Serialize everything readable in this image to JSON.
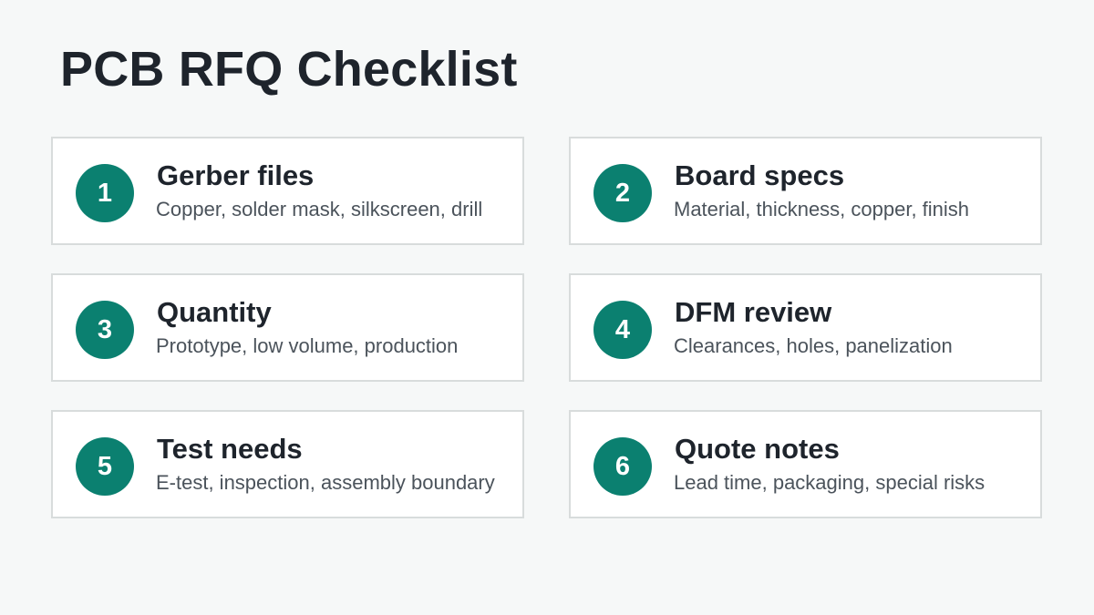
{
  "title": "PCB RFQ Checklist",
  "colors": {
    "background": "#f6f8f8",
    "card_background": "#ffffff",
    "card_border": "#d8dcdc",
    "accent": "#0b8070",
    "title_text": "#1e242c",
    "description_text": "#4b535b"
  },
  "items": [
    {
      "number": "1",
      "title": "Gerber files",
      "description": "Copper, solder mask, silkscreen, drill"
    },
    {
      "number": "2",
      "title": "Board specs",
      "description": "Material, thickness, copper, finish"
    },
    {
      "number": "3",
      "title": "Quantity",
      "description": "Prototype, low volume, production"
    },
    {
      "number": "4",
      "title": "DFM review",
      "description": "Clearances, holes, panelization"
    },
    {
      "number": "5",
      "title": "Test needs",
      "description": "E-test, inspection, assembly boundary"
    },
    {
      "number": "6",
      "title": "Quote notes",
      "description": "Lead time, packaging, special risks"
    }
  ]
}
